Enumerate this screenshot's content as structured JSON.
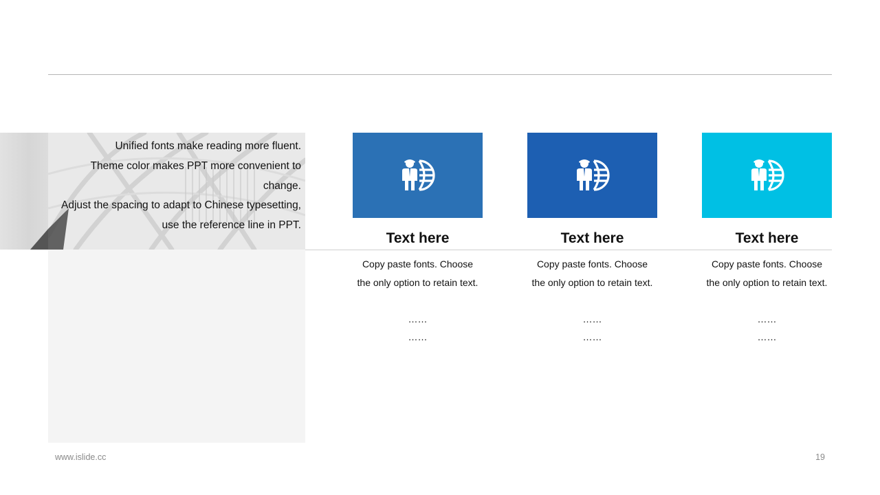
{
  "intro": {
    "lines": [
      "Unified fonts make reading more fluent.",
      "Theme color makes PPT more convenient to",
      "change.",
      "Adjust the spacing to adapt to Chinese typesetting,",
      "use the reference line in PPT."
    ]
  },
  "cards": [
    {
      "title": "Text here",
      "desc": "Copy paste fonts. Choose the only option to retain text.",
      "dots1": "……",
      "dots2": "……",
      "color": "#2b71b5",
      "icon": "businessman-globe-icon"
    },
    {
      "title": "Text here",
      "desc": "Copy paste fonts. Choose the only option to retain text.",
      "dots1": "……",
      "dots2": "……",
      "color": "#1d5fb2",
      "icon": "businessman-globe-icon"
    },
    {
      "title": "Text here",
      "desc": "Copy paste fonts. Choose the only option to retain text.",
      "dots1": "……",
      "dots2": "……",
      "color": "#00c0e4",
      "icon": "businessman-globe-icon"
    }
  ],
  "footer": {
    "website": "www.islide.cc",
    "page_number": "19"
  }
}
